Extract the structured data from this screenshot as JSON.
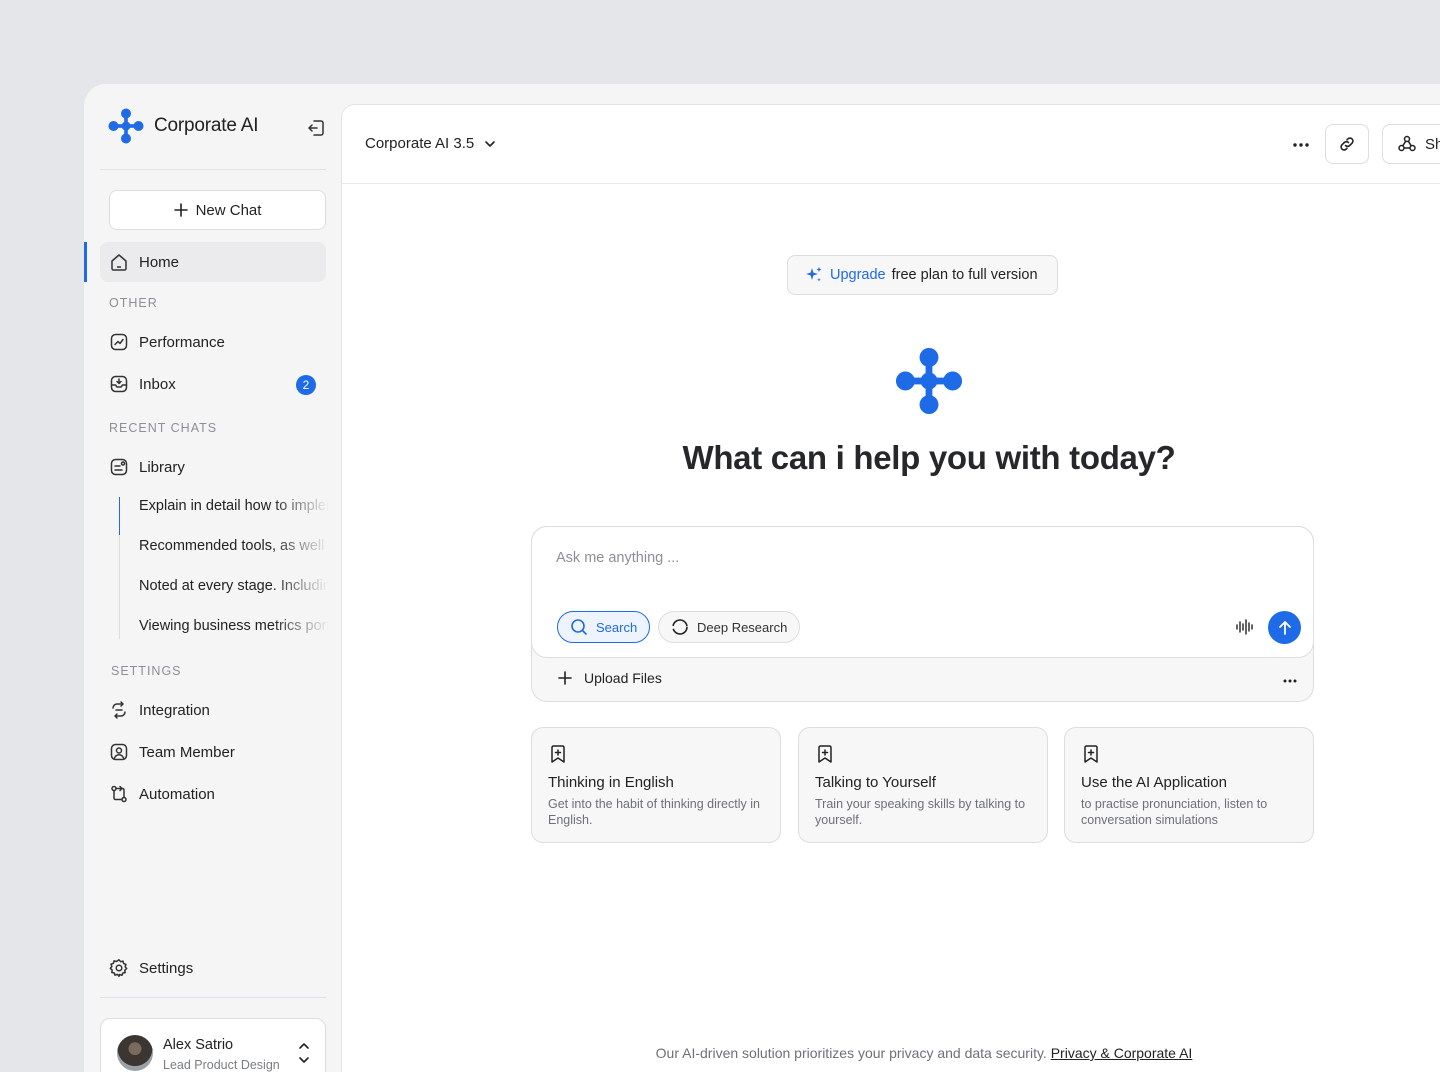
{
  "brand": {
    "name": "Corporate AI"
  },
  "sidebar": {
    "new_chat_label": "New Chat",
    "home_label": "Home",
    "other_label": "OTHER",
    "performance_label": "Performance",
    "inbox_label": "Inbox",
    "inbox_count": "2",
    "recent_label": "RECENT CHATS",
    "library_label": "Library",
    "recent_chats": [
      "Explain in detail how to implement",
      "Recommended tools, as well as",
      "Noted at every stage. Including",
      "Viewing business metrics portal"
    ],
    "settings_section_label": "SETTINGS",
    "integration_label": "Integration",
    "team_member_label": "Team Member",
    "automation_label": "Automation",
    "settings_label": "Settings"
  },
  "user": {
    "name": "Alex Satrio",
    "role": "Lead Product Design"
  },
  "topbar": {
    "model": "Corporate AI 3.5",
    "share_label": "Share"
  },
  "upgrade": {
    "highlight": "Upgrade",
    "rest": "free plan to full version"
  },
  "hero": {
    "title": "What can i help you with today?"
  },
  "composer": {
    "placeholder": "Ask me anything ...",
    "search_label": "Search",
    "deep_research_label": "Deep Research",
    "upload_label": "Upload Files"
  },
  "cards": [
    {
      "title": "Thinking in English",
      "desc": "Get into the habit of thinking directly in English."
    },
    {
      "title": "Talking to Yourself",
      "desc": "Train your speaking skills by talking to yourself."
    },
    {
      "title": "Use the AI Application",
      "desc": "to practise pronunciation, listen to conversation simulations"
    }
  ],
  "footer": {
    "text": "Our AI-driven solution prioritizes your privacy and data security.",
    "link": "Privacy & Corporate AI"
  },
  "colors": {
    "accent": "#1f6ae6",
    "background": "#e4e6ea",
    "sidebar": "#f5f5f6"
  },
  "icons": [
    "logo-icon",
    "collapse-icon",
    "plus-icon",
    "home-icon",
    "performance-icon",
    "inbox-icon",
    "library-icon",
    "integration-icon",
    "team-icon",
    "automation-icon",
    "gear-icon",
    "chevron-updown-icon",
    "chevron-down-icon",
    "more-icon",
    "link-icon",
    "share-icon",
    "sparkle-icon",
    "search-icon",
    "circle-icon",
    "waveform-icon",
    "arrow-up-icon",
    "bookmark-plus-icon"
  ]
}
